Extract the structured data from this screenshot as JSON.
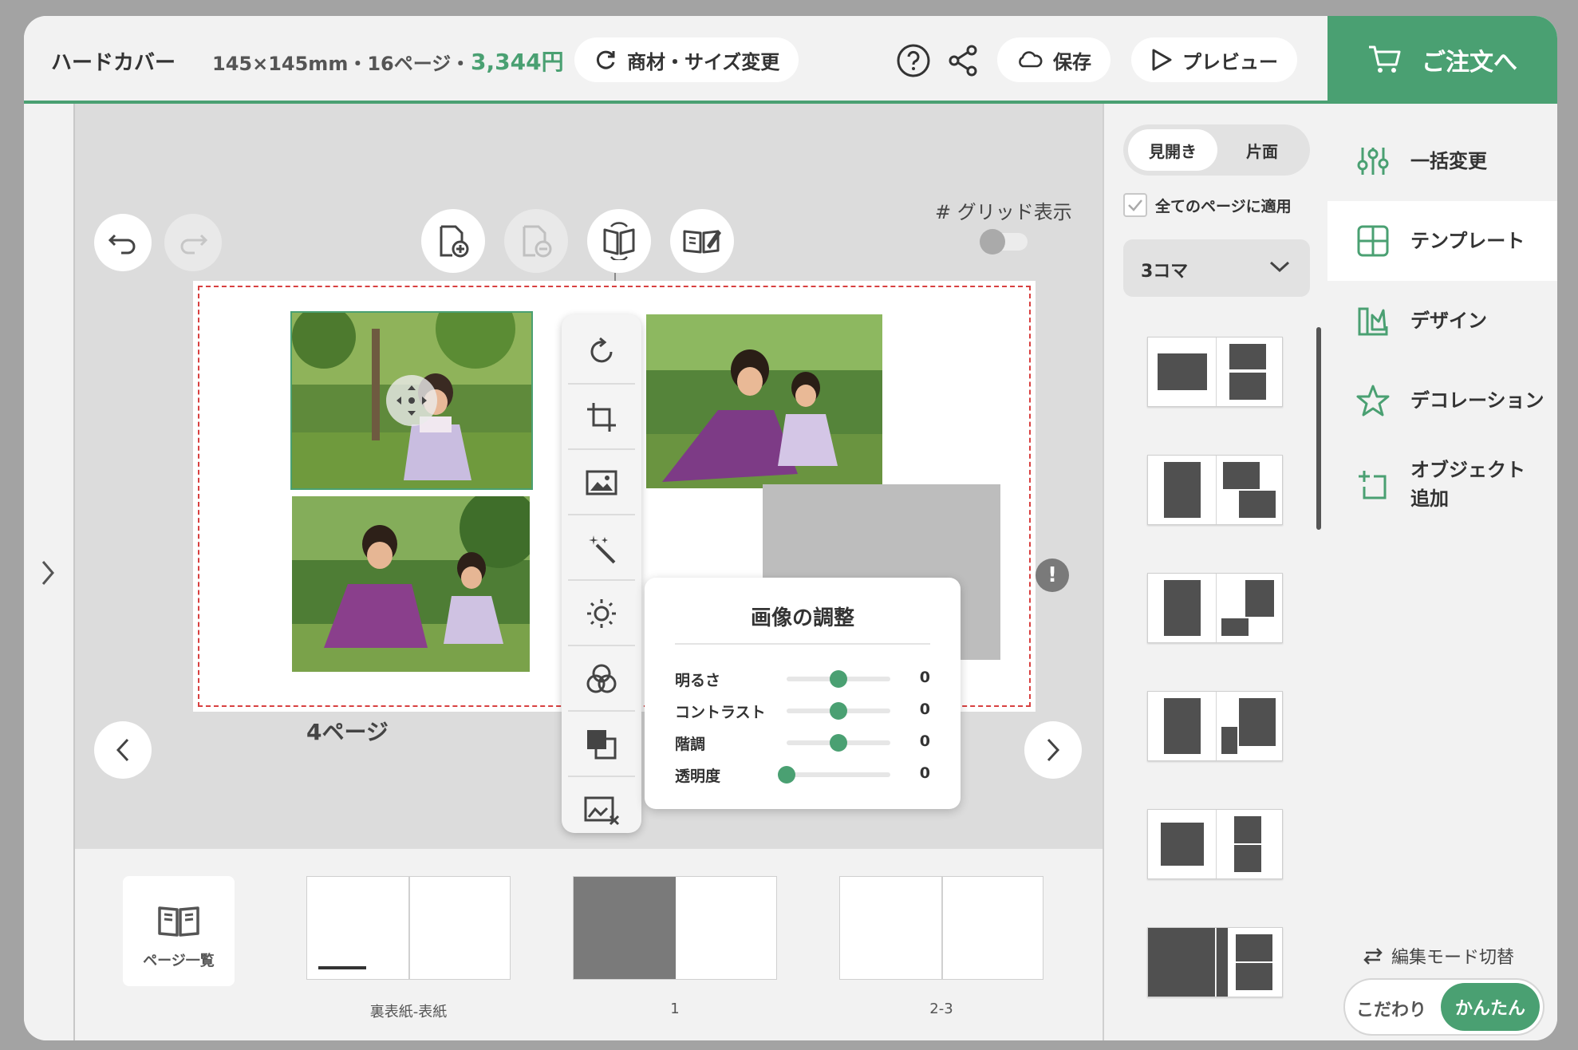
{
  "header": {
    "product_title": "ハードカバー",
    "spec": "145×145mm・16ページ・",
    "price": "3,344円",
    "change_label": "商材・サイズ変更",
    "save_label": "保存",
    "preview_label": "プレビュー",
    "order_label": "ご注文へ",
    "icons": [
      "refresh-icon",
      "help-icon",
      "share-icon",
      "cloud-icon",
      "play-icon",
      "cart-icon"
    ]
  },
  "canvas": {
    "grid_label": "グリッド表示",
    "grid_enabled": false,
    "page_label": "4ページ",
    "warning_mark": "!"
  },
  "adjust_panel": {
    "title": "画像の調整",
    "rows": [
      {
        "label": "明るさ",
        "value": "0",
        "level": 0.5
      },
      {
        "label": "コントラスト",
        "value": "0",
        "level": 0.5
      },
      {
        "label": "階調",
        "value": "0",
        "level": 0.5
      },
      {
        "label": "透明度",
        "value": "0",
        "level": 0.0
      }
    ]
  },
  "strip": {
    "page_list_label": "ページ一覧",
    "thumbs": [
      {
        "caption": "裏表紙-表紙"
      },
      {
        "caption": "1"
      },
      {
        "caption": "2-3"
      }
    ]
  },
  "templates": {
    "seg_spread": "見開き",
    "seg_single": "片面",
    "apply_all_label": "全てのページに適用",
    "apply_all_checked": true,
    "layout_select": "3コマ"
  },
  "menu": {
    "items": [
      {
        "label": "一括変更",
        "icon": "sliders-icon"
      },
      {
        "label": "テンプレート",
        "icon": "layout-icon"
      },
      {
        "label": "デザイン",
        "icon": "design-icon"
      },
      {
        "label": "デコレーション",
        "icon": "star-icon"
      },
      {
        "label": "オブジェクト追加",
        "icon": "add-object-icon"
      }
    ],
    "mode_switch_label": "編集モード切替",
    "mode_detail": "こだわり",
    "mode_easy": "かんたん"
  },
  "colors": {
    "accent": "#4aa072",
    "placeholder": "#bdbdbd",
    "guide": "#d84040"
  }
}
